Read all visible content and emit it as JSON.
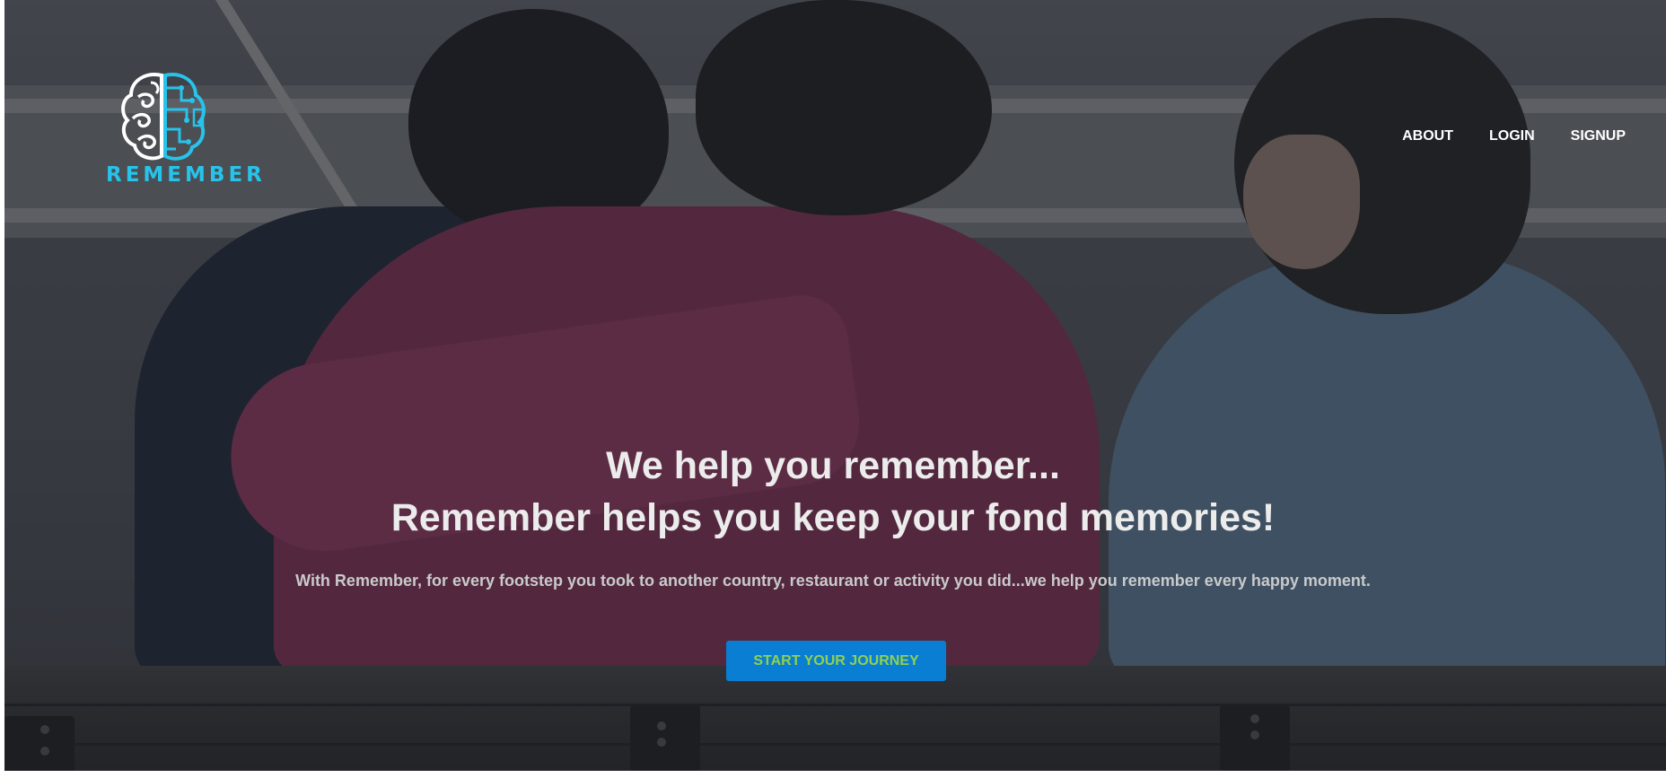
{
  "brand": {
    "name": "REMEMBER",
    "accent_color": "#27c3ea",
    "logo_icon": "brain-circuit-icon"
  },
  "nav": {
    "items": [
      {
        "label": "ABOUT"
      },
      {
        "label": "LOGIN"
      },
      {
        "label": "SIGNUP"
      }
    ]
  },
  "hero": {
    "heading_line1": "We help you remember...",
    "heading_line2": "Remember helps you keep your fond memories!",
    "subheading": "With Remember, for every footstep you took to another country, restaurant or activity you did...we help you remember every happy moment.",
    "cta_label": "START YOUR JOURNEY",
    "cta_bg_color": "#0a7ed2",
    "cta_text_color": "#8fd14f"
  }
}
